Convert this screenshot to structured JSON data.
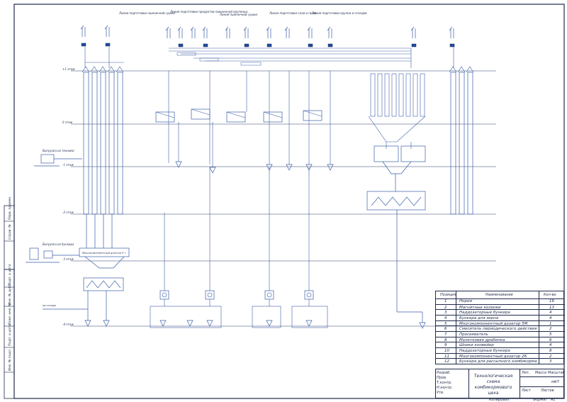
{
  "line_captions": {
    "l1": "Линия подготовки пшеничной сушки",
    "l2": "Линия подготовки продуктов пшеничной крупяных",
    "l3": "Линия пшеничной сушки",
    "l4": "Линия подготовки соли и пыли",
    "l5": "Линия подготовки крупки и отходов"
  },
  "floor_levels": [
    "+1 этаж",
    "0 этаж",
    "-1 этаж",
    "-2 этаж",
    "-3 этаж",
    "-4 этаж"
  ],
  "notes": {
    "n1": "Выгрузка из техники",
    "n2": "Выгрузка из бункера",
    "n3": "Многокомпонентный дозатор 9 т",
    "n4": "на отходы"
  },
  "spec_table": {
    "headers": {
      "pos": "Позиция",
      "name": "Наименование",
      "qty": "Кол-во"
    },
    "rows": [
      {
        "pos": "1",
        "name": "Нории",
        "qty": "16"
      },
      {
        "pos": "2",
        "name": "Магнитные колонки",
        "qty": "13"
      },
      {
        "pos": "3",
        "name": "Наддозаторные бункера",
        "qty": "4"
      },
      {
        "pos": "4",
        "name": "Бункера для зерна",
        "qty": "4"
      },
      {
        "pos": "5",
        "name": "Многокомпонентный дозатор 5М",
        "qty": "1"
      },
      {
        "pos": "6",
        "name": "Смеситель периодического действия",
        "qty": "2"
      },
      {
        "pos": "7",
        "name": "Просеиватель",
        "qty": "5"
      },
      {
        "pos": "8",
        "name": "Молотковая дробилка",
        "qty": "6"
      },
      {
        "pos": "9",
        "name": "Шнеки конвейер",
        "qty": "4"
      },
      {
        "pos": "10",
        "name": "Наддозаторные бункера",
        "qty": "8"
      },
      {
        "pos": "11",
        "name": "Многокомпонентный дозатор 2К",
        "qty": "2"
      },
      {
        "pos": "12",
        "name": "Бункера для рассыпного комбикорма",
        "qty": "3"
      }
    ]
  },
  "title_block": {
    "title": "Технологическая схема комбикормового цеха",
    "lit_label": "Лит.",
    "mass_label": "Масса",
    "scale_label": "Масштаб",
    "scale_value": "нет",
    "sheet_label": "Лист",
    "sheets_label": "Листов",
    "copied": "Копировал",
    "format": "Формат",
    "format_value": "А1",
    "left_labels": [
      "Изм.",
      "Лист",
      "№ докум.",
      "Подп.",
      "Дата"
    ],
    "role_labels": [
      "Разраб.",
      "Пров.",
      "Т.контр.",
      "Н.контр.",
      "Утв."
    ]
  },
  "margin_labels": [
    "Перв. примен.",
    "Справ. №",
    "Подп. и дата",
    "Инв. № дубл.",
    "Взам. инв. №",
    "Подп. и дата",
    "Инв. № подл."
  ],
  "colors": {
    "line": "#3a5ea8",
    "ink": "#1f2a4a",
    "frame": "#1f2a4a"
  }
}
